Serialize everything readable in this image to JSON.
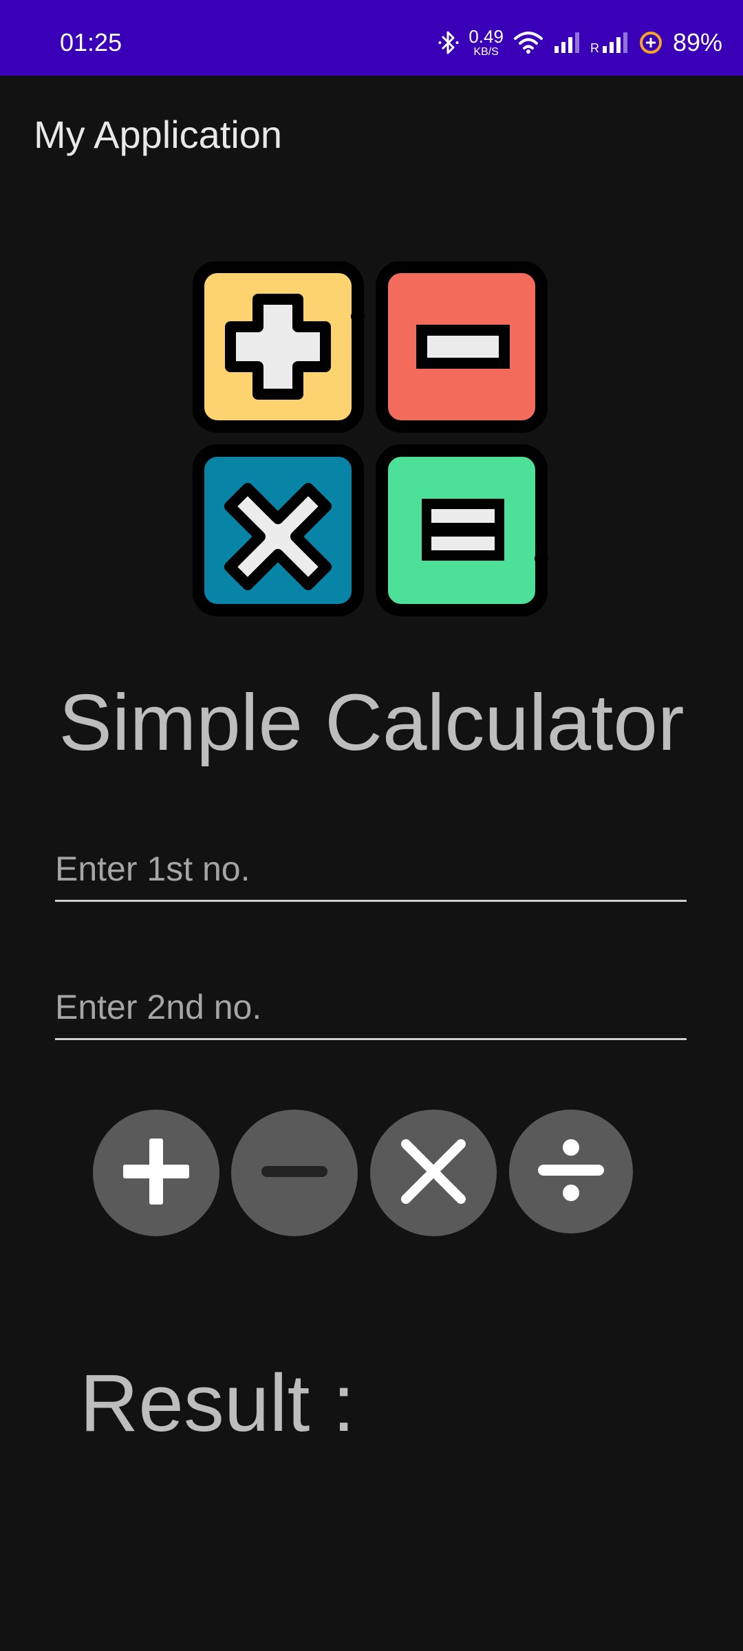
{
  "status_bar": {
    "time": "01:25",
    "net_speed_value": "0.49",
    "net_speed_unit": "KB/S",
    "roaming_label": "R",
    "battery_percent": "89%",
    "background": "#3a00b8"
  },
  "app_bar": {
    "title": "My Application"
  },
  "logo": {
    "icon": "calculator-logo-icon",
    "tiles": [
      {
        "symbol": "plus",
        "color": "#fdd36f"
      },
      {
        "symbol": "minus",
        "color": "#f26b5b"
      },
      {
        "symbol": "multiply",
        "color": "#0784a6"
      },
      {
        "symbol": "equals",
        "color": "#4de098"
      }
    ]
  },
  "main": {
    "heading": "Simple Calculator",
    "input1_placeholder": "Enter 1st no.",
    "input2_placeholder": "Enter 2nd no.",
    "operators": [
      {
        "name": "add",
        "icon": "plus-icon"
      },
      {
        "name": "subtract",
        "icon": "minus-icon"
      },
      {
        "name": "multiply",
        "icon": "multiply-icon"
      },
      {
        "name": "divide",
        "icon": "divide-icon"
      }
    ],
    "result_label": "Result :"
  },
  "colors": {
    "background": "#121212",
    "button": "#5a5a5a",
    "text": "#bdbdbd"
  }
}
